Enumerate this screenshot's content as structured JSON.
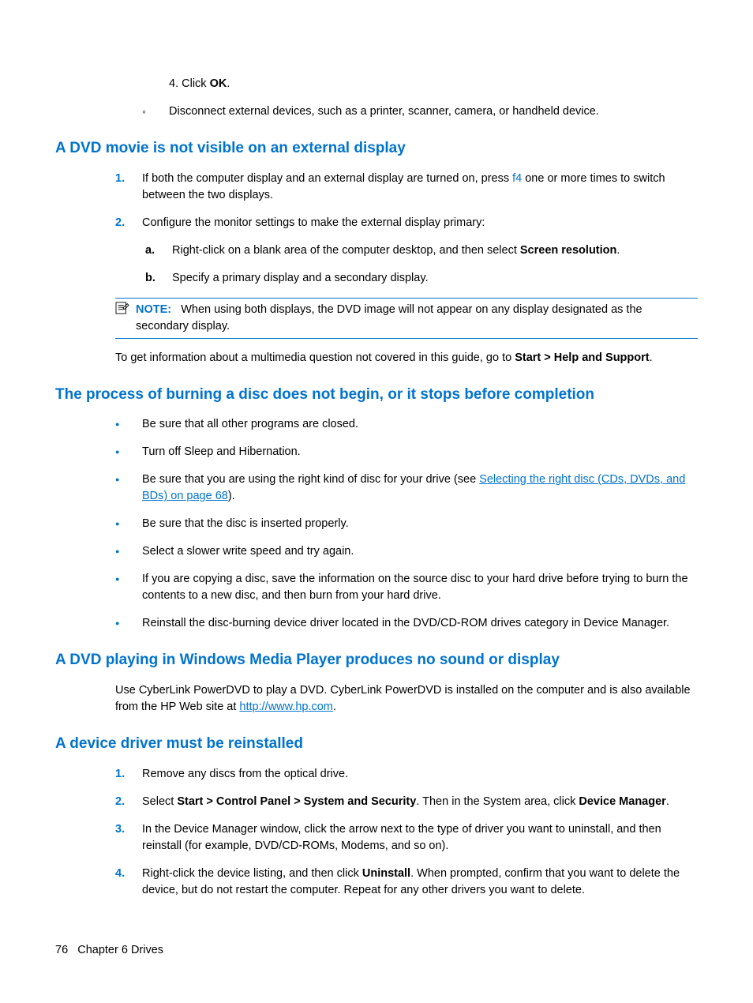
{
  "top": {
    "step4_pre": "4. Click ",
    "step4_b": "OK",
    "step4_post": ".",
    "circ1": "Disconnect external devices, such as a printer, scanner, camera, or handheld device."
  },
  "s1": {
    "heading": "A DVD movie is not visible on an external display",
    "li1a": "If both the computer display and an external display are turned on, press ",
    "li1key": "f4",
    "li1b": " one or more times to switch between the two displays.",
    "li2": "Configure the monitor settings to make the external display primary:",
    "a_pre": "Right-click on a blank area of the computer desktop, and then select ",
    "a_b": "Screen resolution",
    "a_post": ".",
    "b": "Specify a primary display and a secondary display.",
    "note_label": "NOTE:",
    "note_text": "When using both displays, the DVD image will not appear on any display designated as the secondary display.",
    "para_pre": "To get information about a multimedia question not covered in this guide, go to ",
    "para_b": "Start > Help and Support",
    "para_post": "."
  },
  "s2": {
    "heading": "The process of burning a disc does not begin, or it stops before completion",
    "b1": "Be sure that all other programs are closed.",
    "b2": "Turn off Sleep and Hibernation.",
    "b3a": "Be sure that you are using the right kind of disc for your drive (see ",
    "b3link": "Selecting the right disc (CDs, DVDs, and BDs) on page 68",
    "b3b": ").",
    "b4": "Be sure that the disc is inserted properly.",
    "b5": "Select a slower write speed and try again.",
    "b6": "If you are copying a disc, save the information on the source disc to your hard drive before trying to burn the contents to a new disc, and then burn from your hard drive.",
    "b7": "Reinstall the disc-burning device driver located in the DVD/CD-ROM drives category in Device Manager."
  },
  "s3": {
    "heading": "A DVD playing in Windows Media Player produces no sound or display",
    "para_a": "Use CyberLink PowerDVD to play a DVD. CyberLink PowerDVD is installed on the computer and is also available from the HP Web site at ",
    "para_link": "http://www.hp.com",
    "para_b": "."
  },
  "s4": {
    "heading": "A device driver must be reinstalled",
    "li1": "Remove any discs from the optical drive.",
    "li2a": "Select ",
    "li2b": "Start > Control Panel > System and Security",
    "li2c": ". Then in the System area, click ",
    "li2d": "Device Manager",
    "li2e": ".",
    "li3": "In the Device Manager window, click the arrow next to the type of driver you want to uninstall, and then reinstall (for example, DVD/CD-ROMs, Modems, and so on).",
    "li4a": "Right-click the device listing, and then click ",
    "li4b": "Uninstall",
    "li4c": ". When prompted, confirm that you want to delete the device, but do not restart the computer. Repeat for any other drivers you want to delete."
  },
  "footer": {
    "page": "76",
    "chapter": "Chapter 6   Drives"
  }
}
